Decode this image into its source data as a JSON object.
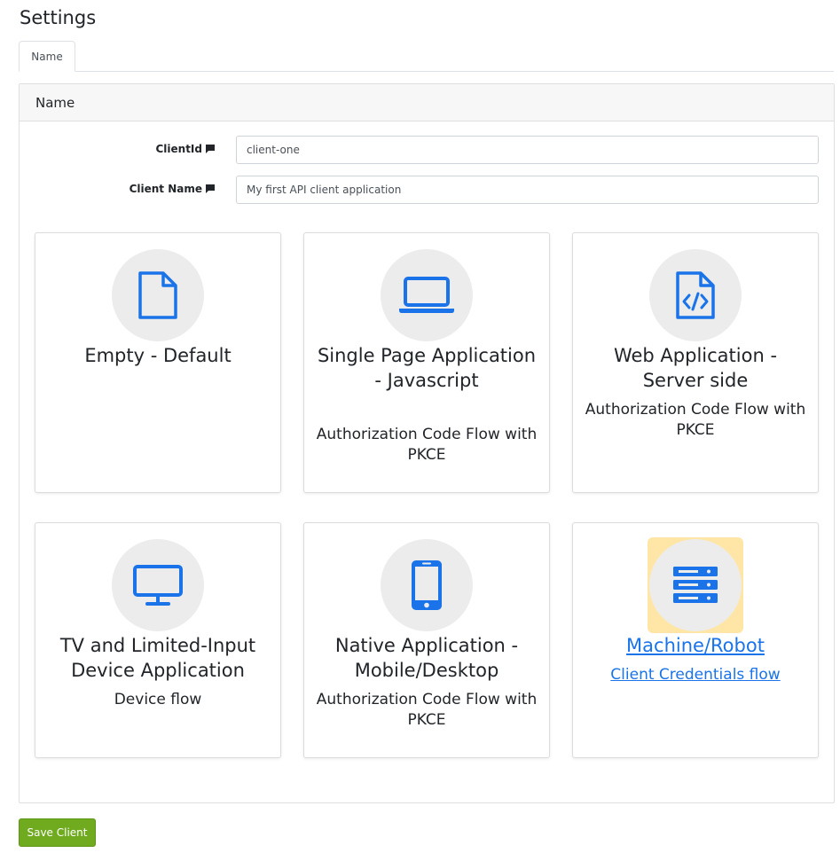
{
  "page": {
    "title": "Settings"
  },
  "tabs": [
    {
      "label": "Name"
    }
  ],
  "panel": {
    "header": "Name"
  },
  "form": {
    "client_id": {
      "label": "ClientId",
      "value": "client-one"
    },
    "client_name": {
      "label": "Client Name",
      "value": "My first API client application"
    }
  },
  "client_types": [
    {
      "title": "Empty - Default",
      "subtitle": "",
      "icon": "file-icon"
    },
    {
      "title": "Single Page Application - Javascript",
      "subtitle": "Authorization Code Flow with PKCE",
      "icon": "laptop-icon"
    },
    {
      "title": "Web Application - Server side",
      "subtitle": "Authorization Code Flow with PKCE",
      "icon": "code-file-icon"
    },
    {
      "title": "TV and Limited-Input Device Application",
      "subtitle": "Device flow",
      "icon": "monitor-icon"
    },
    {
      "title": "Native Application - Mobile/Desktop",
      "subtitle": "Authorization Code Flow with PKCE",
      "icon": "mobile-icon"
    },
    {
      "title": "Machine/Robot",
      "subtitle": "Client Credentials flow",
      "icon": "server-icon",
      "selected": true
    }
  ],
  "actions": {
    "save_label": "Save Client"
  },
  "colors": {
    "accent": "#1a73e8",
    "save": "#6faa1f",
    "icon_bg": "#ececec",
    "highlight": "#ffe6a6"
  }
}
